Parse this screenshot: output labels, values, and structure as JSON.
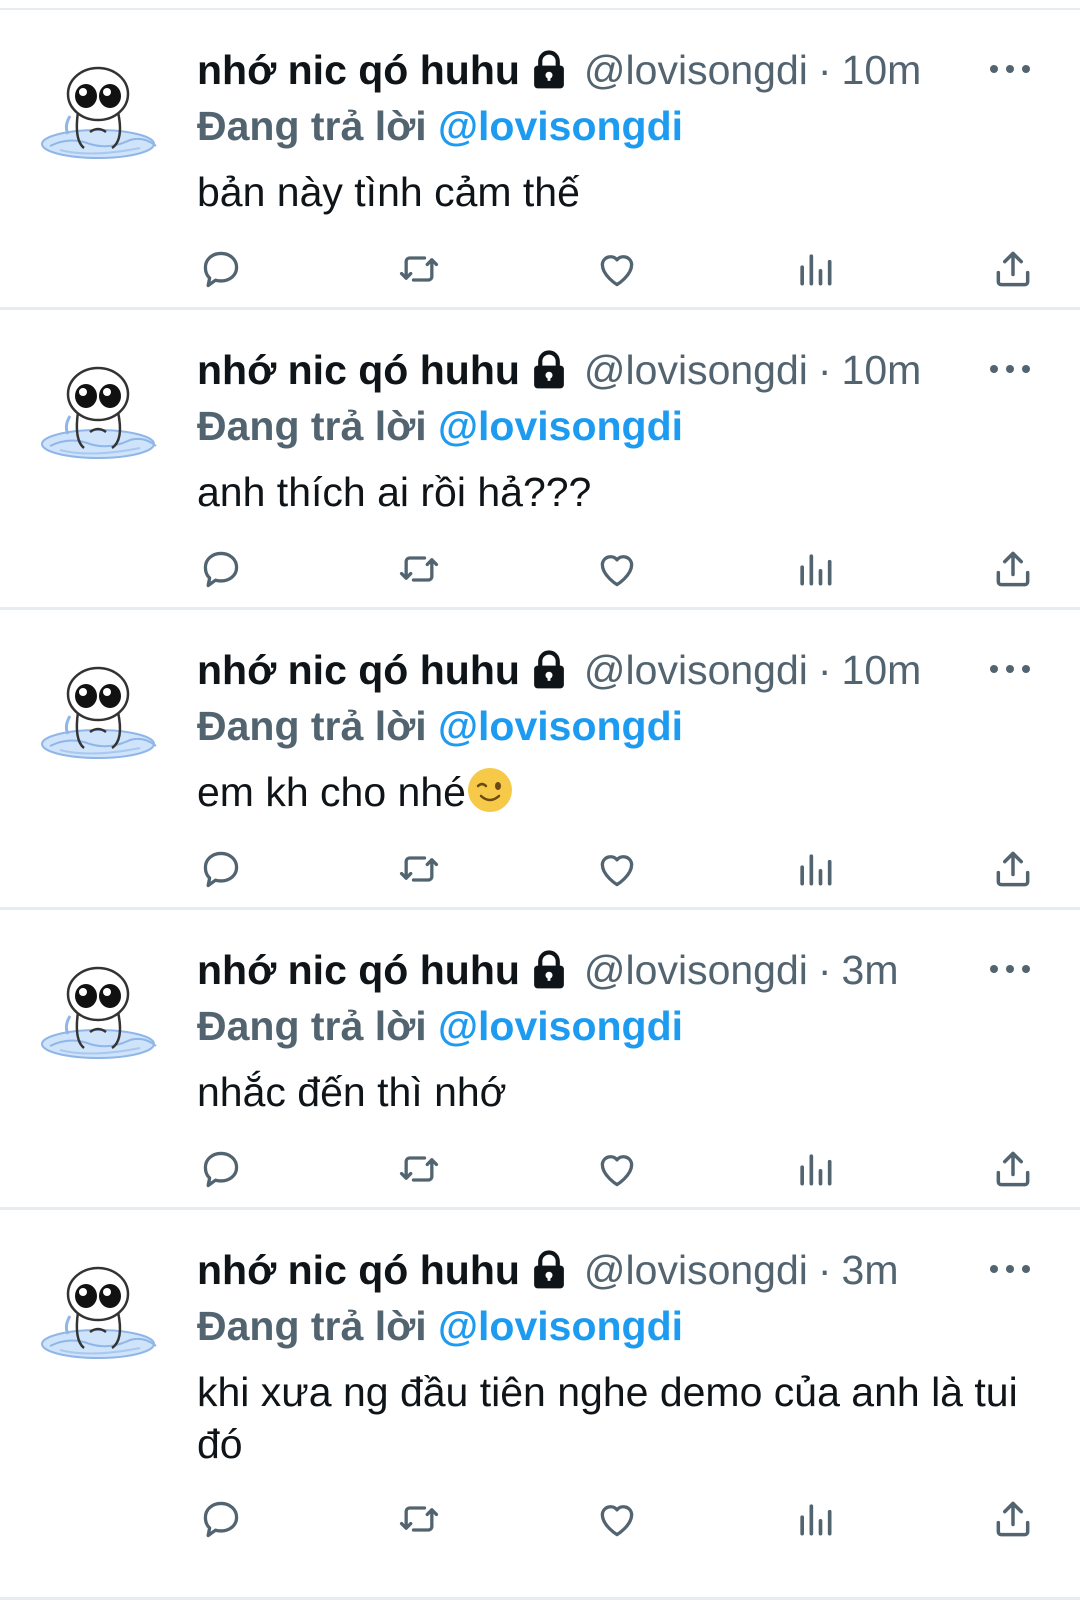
{
  "tweets": [
    {
      "author": "nhớ nic qó huhu",
      "handle": "@lovisongdi",
      "dot": "·",
      "time": "10m",
      "reply_prefix": "Đang trả lời",
      "reply_to": "@lovisongdi",
      "text": "bản này tình cảm thế",
      "emoji": ""
    },
    {
      "author": "nhớ nic qó huhu",
      "handle": "@lovisongdi",
      "dot": "·",
      "time": "10m",
      "reply_prefix": "Đang trả lời",
      "reply_to": "@lovisongdi",
      "text": "anh thích ai rồi hả???",
      "emoji": ""
    },
    {
      "author": "nhớ nic qó huhu",
      "handle": "@lovisongdi",
      "dot": "·",
      "time": "10m",
      "reply_prefix": "Đang trả lời",
      "reply_to": "@lovisongdi",
      "text": "em kh cho nhé",
      "emoji": "winking-face"
    },
    {
      "author": "nhớ nic qó huhu",
      "handle": "@lovisongdi",
      "dot": "·",
      "time": "3m",
      "reply_prefix": "Đang trả lời",
      "reply_to": "@lovisongdi",
      "text": "nhắc đến thì nhớ",
      "emoji": ""
    },
    {
      "author": "nhớ nic qó huhu",
      "handle": "@lovisongdi",
      "dot": "·",
      "time": "3m",
      "reply_prefix": "Đang trả lời",
      "reply_to": "@lovisongdi",
      "text": "khi xưa ng đầu tiên nghe demo của anh là tui đó",
      "emoji": ""
    }
  ],
  "icons": {
    "avatar": "cartoon-avatar",
    "lock": "lock-icon",
    "more": "more-icon",
    "reply": "reply-icon",
    "retweet": "retweet-icon",
    "like": "heart-icon",
    "analytics": "analytics-icon",
    "share": "share-icon"
  },
  "colors": {
    "text": "#0f1419",
    "secondary": "#536471",
    "mention": "#1d9bf0",
    "separator": "#e6ecf0"
  }
}
